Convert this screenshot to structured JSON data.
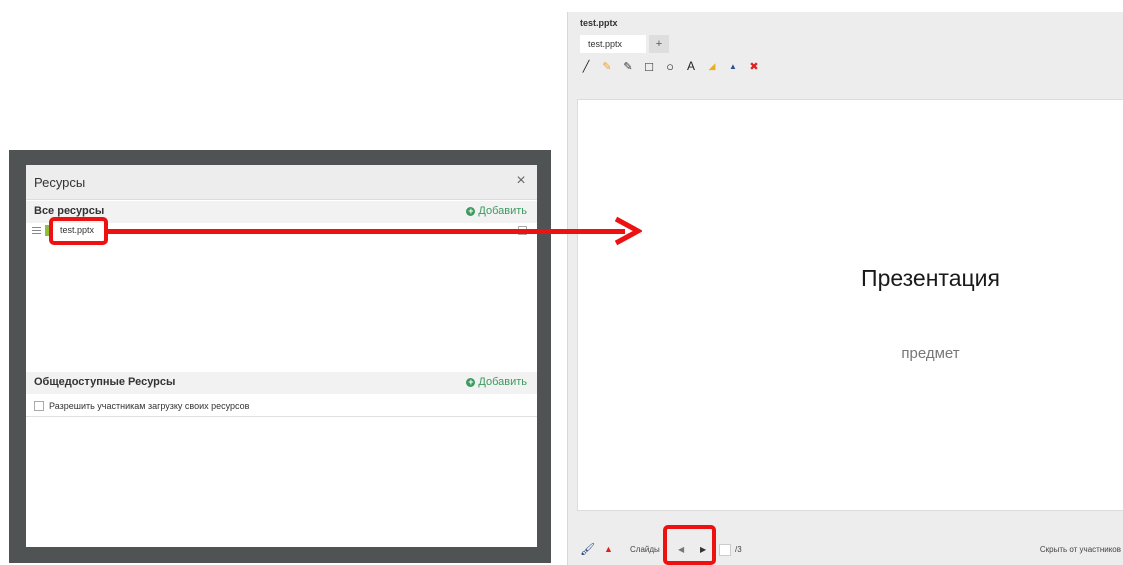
{
  "resources_dialog": {
    "title": "Ресурсы",
    "close_glyph": "×",
    "all_resources": {
      "heading": "Все ресурсы",
      "add_label": "Добавить",
      "items": [
        {
          "name": "test.pptx"
        }
      ]
    },
    "public_resources": {
      "heading": "Общедоступные Ресурсы",
      "add_label": "Добавить",
      "allow_upload_label": "Разрешить участникам загрузку своих ресурсов"
    }
  },
  "viewer": {
    "window_title": "test.pptx",
    "tabs": [
      {
        "label": "test.pptx"
      }
    ],
    "add_tab_glyph": "+",
    "toolbar": [
      {
        "name": "line-tool",
        "glyph": "╱",
        "color": "#222222"
      },
      {
        "name": "highlighter-tool",
        "glyph": "✎",
        "color": "#f0a030"
      },
      {
        "name": "pen-tool",
        "glyph": "✎",
        "color": "#333333"
      },
      {
        "name": "rectangle-tool",
        "glyph": "□",
        "color": "#222222"
      },
      {
        "name": "ellipse-tool",
        "glyph": "○",
        "color": "#222222"
      },
      {
        "name": "text-tool",
        "glyph": "A",
        "color": "#222222"
      },
      {
        "name": "fill-tool",
        "glyph": "◢",
        "color": "#e8b020"
      },
      {
        "name": "pointer-tool",
        "glyph": "▲",
        "color": "#2a4f8a"
      },
      {
        "name": "clear-tool",
        "glyph": "✖",
        "color": "#e02020"
      }
    ],
    "slide": {
      "title": "Презентация",
      "subtitle": "предмет"
    },
    "bottom_bar": {
      "slides_label": "Слайды",
      "prev_glyph": "◀",
      "next_glyph": "▶",
      "page_total": "/3",
      "hide_label": "Скрыть от участников"
    }
  },
  "colors": {
    "annotation_red": "#ee1111",
    "add_green": "#3c9a5f",
    "dark_frame": "#4f5353"
  }
}
